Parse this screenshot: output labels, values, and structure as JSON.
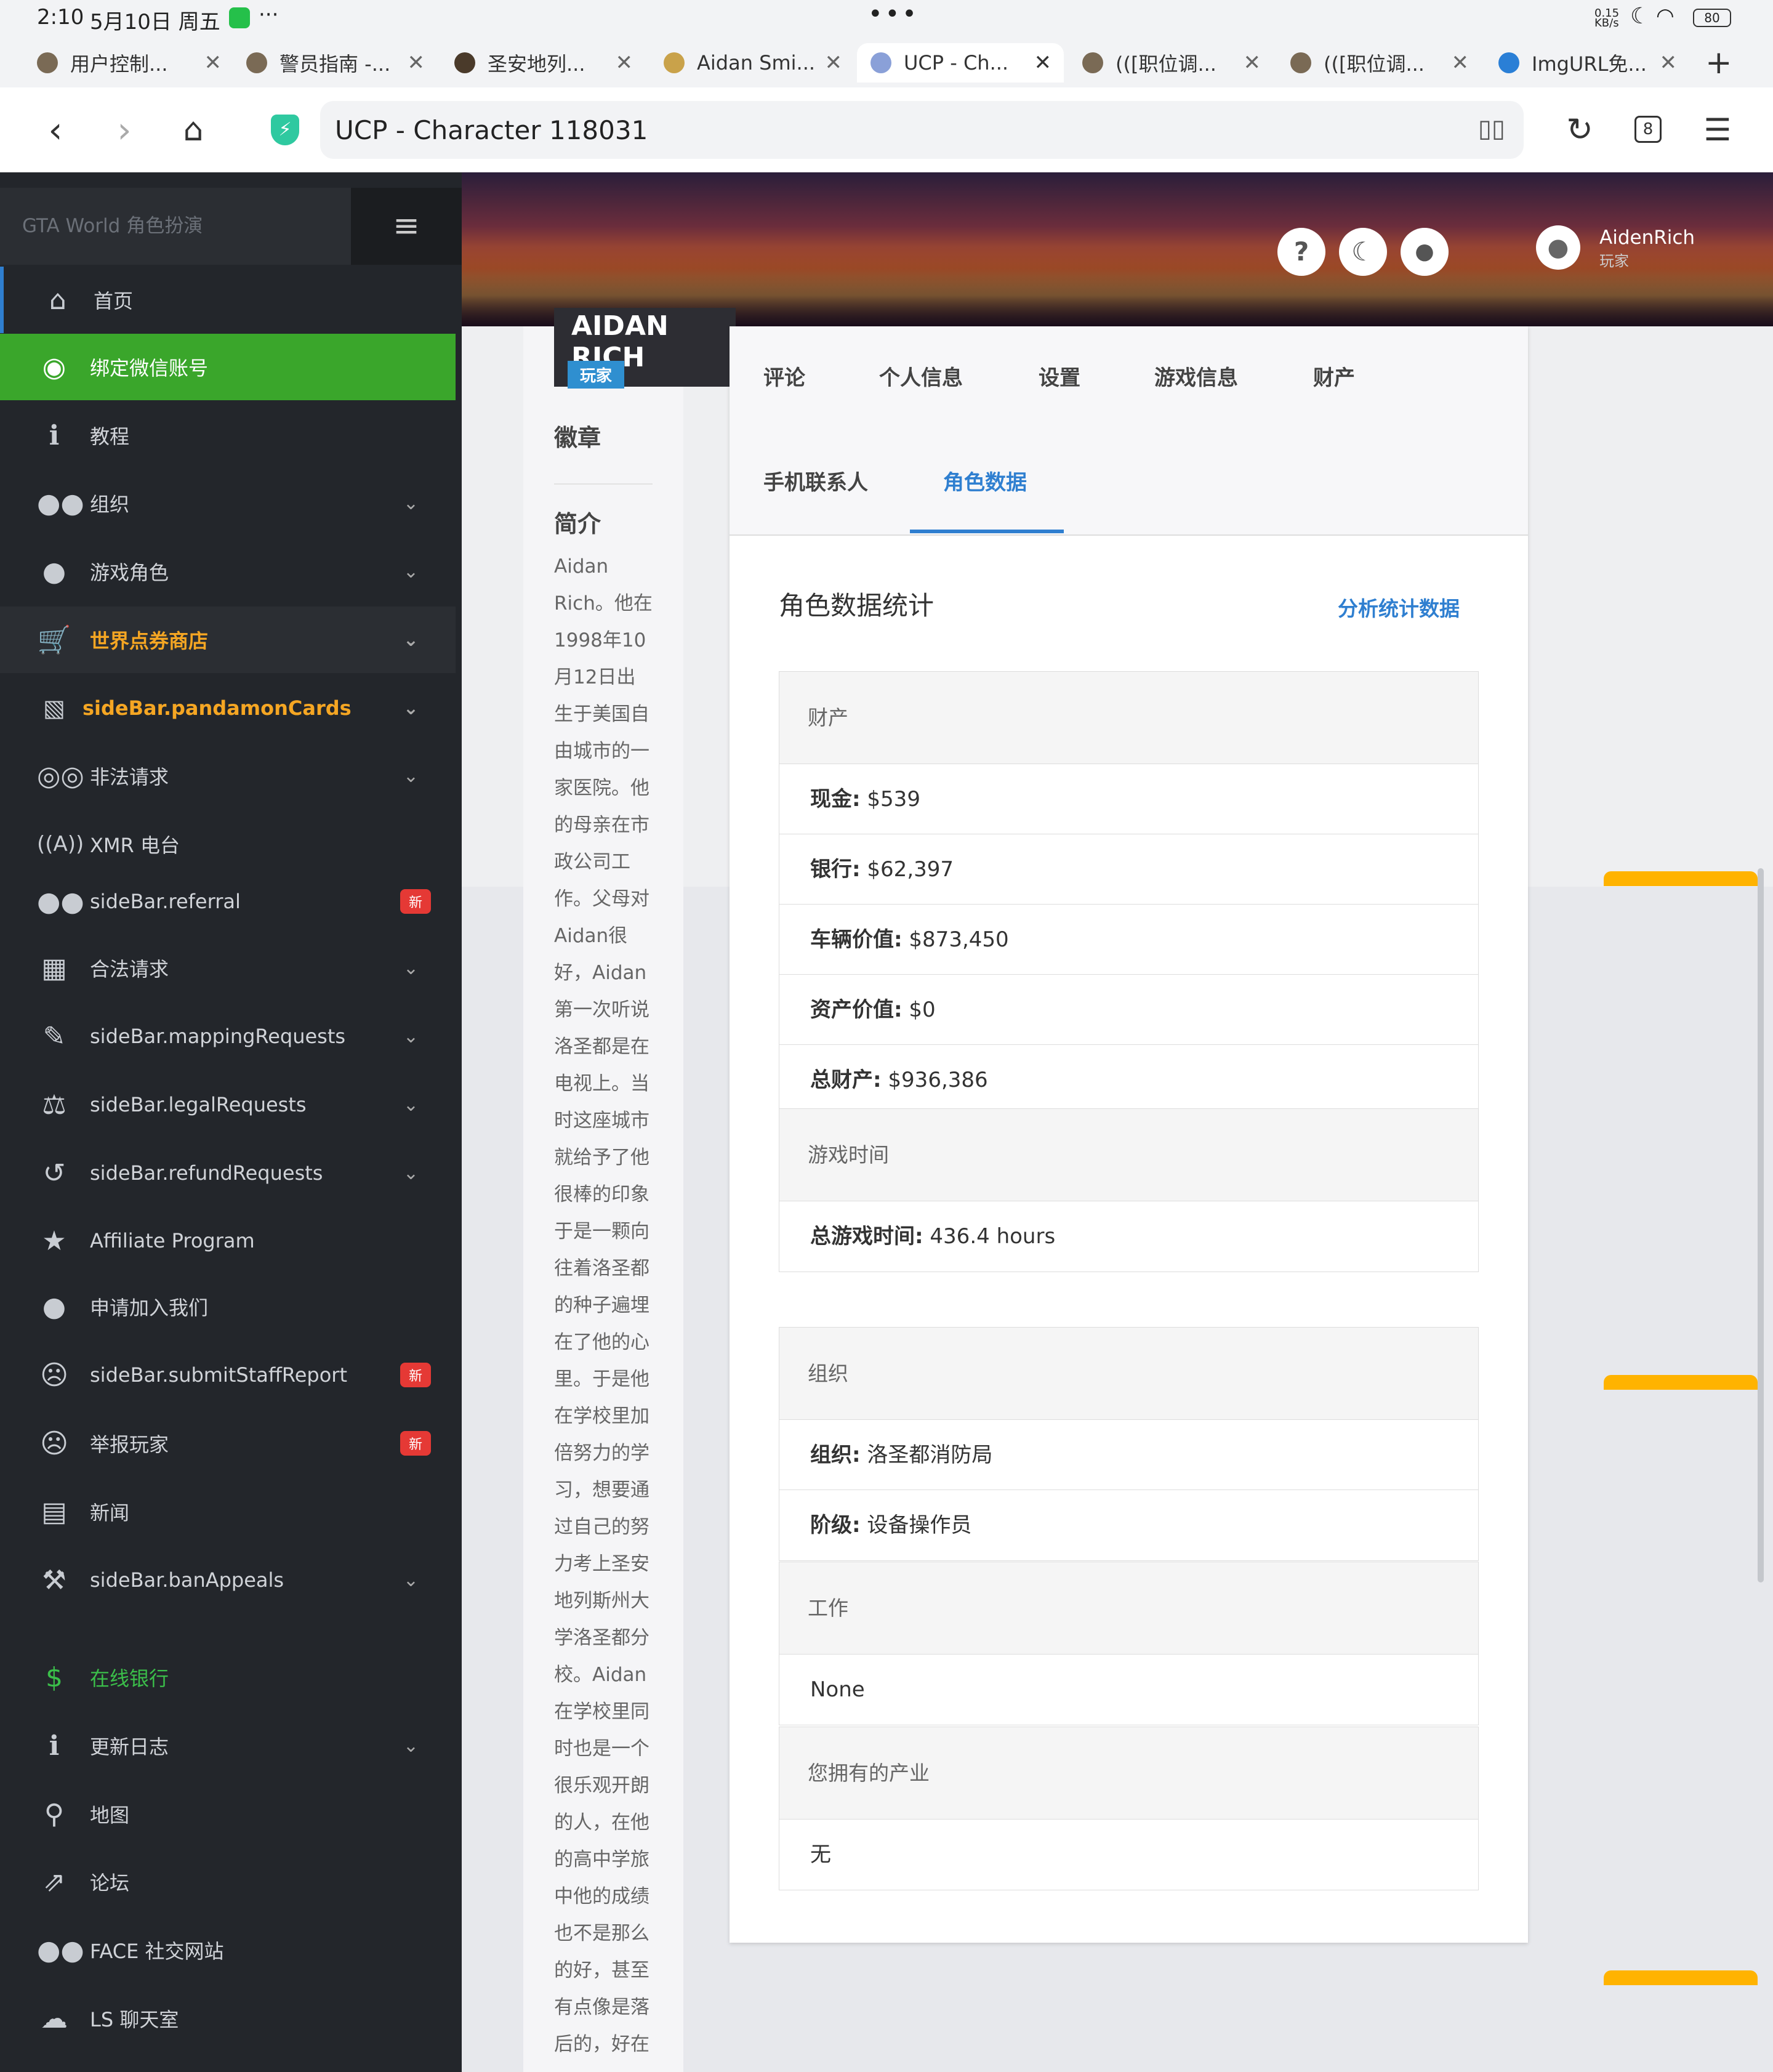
{
  "status": {
    "time": "2:10",
    "date": "5月10日 周五",
    "net_speed": "0.15 KB/s",
    "battery": "80"
  },
  "browser": {
    "tabs": [
      {
        "label": "用户控制..."
      },
      {
        "label": "警员指南 -..."
      },
      {
        "label": "圣安地列..."
      },
      {
        "label": "Aidan Smi..."
      },
      {
        "label": "UCP - Ch..."
      },
      {
        "label": "(([职位调..."
      },
      {
        "label": "(([职位调..."
      },
      {
        "label": "ImgURL免..."
      }
    ],
    "url": "UCP - Character 118031",
    "tab_count": "8"
  },
  "header": {
    "username": "AidenRich",
    "role": "玩家"
  },
  "sidebar": {
    "brand": "GTA World 角色扮演",
    "items": [
      {
        "label": "首页",
        "icon": "home-icon"
      },
      {
        "label": "绑定微信账号",
        "icon": "wechat-icon"
      },
      {
        "label": "教程",
        "icon": "info-icon"
      },
      {
        "label": "组织",
        "icon": "users-icon"
      },
      {
        "label": "游戏角色",
        "icon": "user-icon"
      },
      {
        "label": "世界点券商店",
        "icon": "cart-icon"
      },
      {
        "label": "sideBar.pandamonCards",
        "icon": "image-icon"
      },
      {
        "label": "非法请求",
        "icon": "mask-icon"
      },
      {
        "label": "XMR 电台",
        "icon": "radio-icon"
      },
      {
        "label": "sideBar.referral",
        "icon": "users-icon",
        "badge": "新"
      },
      {
        "label": "合法请求",
        "icon": "building-icon"
      },
      {
        "label": "sideBar.mappingRequests",
        "icon": "brush-icon"
      },
      {
        "label": "sideBar.legalRequests",
        "icon": "scale-icon"
      },
      {
        "label": "sideBar.refundRequests",
        "icon": "undo-icon"
      },
      {
        "label": "Affiliate Program",
        "icon": "star-icon"
      },
      {
        "label": "申请加入我们",
        "icon": "user-tie-icon"
      },
      {
        "label": "sideBar.submitStaffReport",
        "icon": "face-icon",
        "badge": "新"
      },
      {
        "label": "举报玩家",
        "icon": "face-icon",
        "badge": "新"
      },
      {
        "label": "新闻",
        "icon": "newspaper-icon"
      },
      {
        "label": "sideBar.banAppeals",
        "icon": "gavel-icon"
      },
      {
        "label": "在线银行",
        "icon": "dollar-icon"
      },
      {
        "label": "更新日志",
        "icon": "info-icon"
      },
      {
        "label": "地图",
        "icon": "map-pin-icon"
      },
      {
        "label": "论坛",
        "icon": "external-link-icon"
      },
      {
        "label": "FACE 社交网站",
        "icon": "users-icon"
      },
      {
        "label": "LS 聊天室",
        "icon": "chat-icon"
      }
    ]
  },
  "profile": {
    "name": "AIDAN RICH",
    "role": "玩家",
    "badges_title": "徽章",
    "bio_title": "简介",
    "bio_lines": [
      "Aidan",
      "Rich。他在",
      "1998年10",
      "月12日出",
      "生于美国自",
      "由城市的一",
      "家医院。他",
      "的母亲在市",
      "政公司工",
      "作。父母对",
      "Aidan很",
      "好，Aidan",
      "第一次听说",
      "洛圣都是在",
      "电视上。当",
      "时这座城市",
      "就给予了他",
      "很棒的印象",
      "于是一颗向",
      "往着洛圣都",
      "的种子遍埋",
      "在了他的心",
      "里。于是他",
      "在学校里加",
      "倍努力的学",
      "习，想要通",
      "过自己的努",
      "力考上圣安",
      "地列斯州大",
      "学洛圣都分",
      "校。Aidan",
      "在学校里同",
      "时也是一个",
      "很乐观开朗",
      "的人，在他",
      "的高中学旅",
      "中他的成绩",
      "也不是那么",
      "的好，甚至",
      "有点像是落",
      "后的，好在"
    ]
  },
  "main": {
    "tabs_row1": [
      "评论",
      "个人信息",
      "设置",
      "游戏信息",
      "财产"
    ],
    "tabs_row2": [
      "手机联系人",
      "角色数据"
    ],
    "section_title": "角色数据统计",
    "analyze_link": "分析统计数据",
    "panels": [
      {
        "title": "财产",
        "rows": [
          {
            "label": "现金:",
            "value": "$539"
          },
          {
            "label": "银行:",
            "value": "$62,397"
          },
          {
            "label": "车辆价值:",
            "value": "$873,450"
          },
          {
            "label": "资产价值:",
            "value": "$0"
          },
          {
            "label": "总财产:",
            "value": "$936,386"
          }
        ]
      },
      {
        "title": "游戏时间",
        "rows": [
          {
            "label": "总游戏时间:",
            "value": "436.4 hours"
          }
        ]
      },
      {
        "title": "组织",
        "rows": [
          {
            "label": "组织:",
            "value": "洛圣都消防局"
          },
          {
            "label": "阶级:",
            "value": "设备操作员"
          }
        ]
      },
      {
        "title": "工作",
        "rows": [
          {
            "label": "",
            "value": "None"
          }
        ]
      },
      {
        "title": "您拥有的产业",
        "rows": [
          {
            "label": "",
            "value": "无"
          }
        ]
      }
    ]
  },
  "colors": {
    "sidebar_bg": "#23262b",
    "wechat_green": "#3aa62b",
    "accent_blue": "#2f7fd0",
    "shop_orange": "#f5a623",
    "badge_red": "#e53935"
  }
}
